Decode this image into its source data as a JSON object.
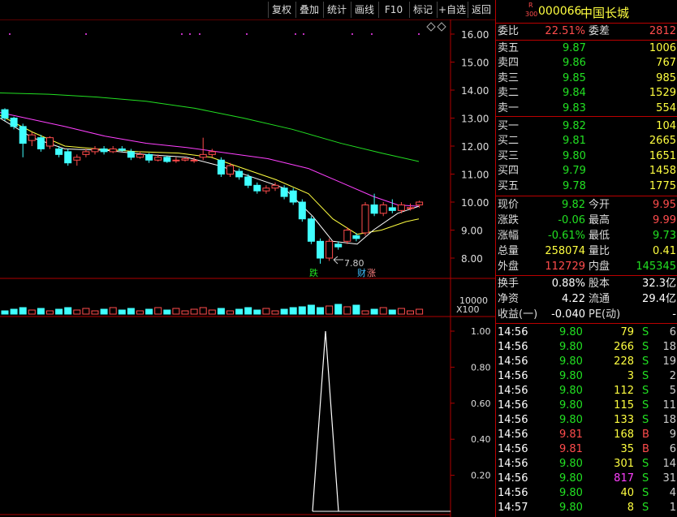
{
  "toolbar": {
    "buttons": [
      "复权",
      "叠加",
      "统计",
      "画线",
      "F10",
      "标记",
      "+自选",
      "返回"
    ]
  },
  "price_axis": {
    "labels": [
      "16.00",
      "15.00",
      "14.00",
      "13.00",
      "12.00",
      "11.00",
      "10.00",
      "9.00",
      "8.00"
    ]
  },
  "volume_axis": {
    "label": "10000",
    "unit": "X100"
  },
  "indicator_axis": {
    "labels": [
      "1.00",
      "0.80",
      "0.60",
      "0.40",
      "0.20"
    ]
  },
  "annotations": {
    "low_price": "7.80",
    "tag_drop": "跌",
    "tag_cai": "财",
    "tag_up": "涨"
  },
  "stock": {
    "badge_top": "R",
    "badge_bottom": "300",
    "code": "000066",
    "name": "中国长城"
  },
  "weibi": {
    "label1": "委比",
    "value1": "22.51%",
    "label2": "委差",
    "value2": "2812"
  },
  "asks": [
    {
      "label": "卖五",
      "price": "9.87",
      "volume": "1006"
    },
    {
      "label": "卖四",
      "price": "9.86",
      "volume": "767"
    },
    {
      "label": "卖三",
      "price": "9.85",
      "volume": "985"
    },
    {
      "label": "卖二",
      "price": "9.84",
      "volume": "1529"
    },
    {
      "label": "卖一",
      "price": "9.83",
      "volume": "554"
    }
  ],
  "bids": [
    {
      "label": "买一",
      "price": "9.82",
      "volume": "104"
    },
    {
      "label": "买二",
      "price": "9.81",
      "volume": "2665"
    },
    {
      "label": "买三",
      "price": "9.80",
      "volume": "1651"
    },
    {
      "label": "买四",
      "price": "9.79",
      "volume": "1458"
    },
    {
      "label": "买五",
      "price": "9.78",
      "volume": "1775"
    }
  ],
  "quote": [
    {
      "l1": "现价",
      "v1": "9.82",
      "l2": "今开",
      "v2": "9.95"
    },
    {
      "l1": "涨跌",
      "v1": "-0.06",
      "l2": "最高",
      "v2": "9.99"
    },
    {
      "l1": "涨幅",
      "v1": "-0.61%",
      "l2": "最低",
      "v2": "9.73"
    },
    {
      "l1": "总量",
      "v1": "258074",
      "l2": "量比",
      "v2": "0.41"
    },
    {
      "l1": "外盘",
      "v1": "112729",
      "l2": "内盘",
      "v2": "145345"
    }
  ],
  "finance": [
    {
      "l1": "换手",
      "v1": "0.88%",
      "l2": "股本",
      "v2": "32.3亿"
    },
    {
      "l1": "净资",
      "v1": "4.22",
      "l2": "流通",
      "v2": "29.4亿"
    },
    {
      "l1": "收益(一)",
      "v1": "-0.040",
      "l2": "PE(动)",
      "v2": "-"
    }
  ],
  "ticks": [
    {
      "time": "14:56",
      "price": "9.80",
      "vol": "79",
      "side": "S",
      "count": "6"
    },
    {
      "time": "14:56",
      "price": "9.80",
      "vol": "266",
      "side": "S",
      "count": "18"
    },
    {
      "time": "14:56",
      "price": "9.80",
      "vol": "228",
      "side": "S",
      "count": "19"
    },
    {
      "time": "14:56",
      "price": "9.80",
      "vol": "3",
      "side": "S",
      "count": "2"
    },
    {
      "time": "14:56",
      "price": "9.80",
      "vol": "112",
      "side": "S",
      "count": "5"
    },
    {
      "time": "14:56",
      "price": "9.80",
      "vol": "115",
      "side": "S",
      "count": "11"
    },
    {
      "time": "14:56",
      "price": "9.80",
      "vol": "133",
      "side": "S",
      "count": "18"
    },
    {
      "time": "14:56",
      "price": "9.81",
      "vol": "168",
      "side": "B",
      "count": "9"
    },
    {
      "time": "14:56",
      "price": "9.81",
      "vol": "35",
      "side": "B",
      "count": "6"
    },
    {
      "time": "14:56",
      "price": "9.80",
      "vol": "301",
      "side": "S",
      "count": "14"
    },
    {
      "time": "14:56",
      "price": "9.80",
      "vol": "817",
      "side": "S",
      "count": "31"
    },
    {
      "time": "14:56",
      "price": "9.80",
      "vol": "40",
      "side": "S",
      "count": "4"
    },
    {
      "time": "14:57",
      "price": "9.80",
      "vol": "8",
      "side": "S",
      "count": "1"
    }
  ],
  "colors": {
    "up": "#ff4c4c",
    "down": "#40ffff",
    "ma5": "#ffffff",
    "ma10": "#ffff40",
    "ma20": "#ff40ff",
    "ma60": "#22e022",
    "grid": "#b00000"
  }
}
